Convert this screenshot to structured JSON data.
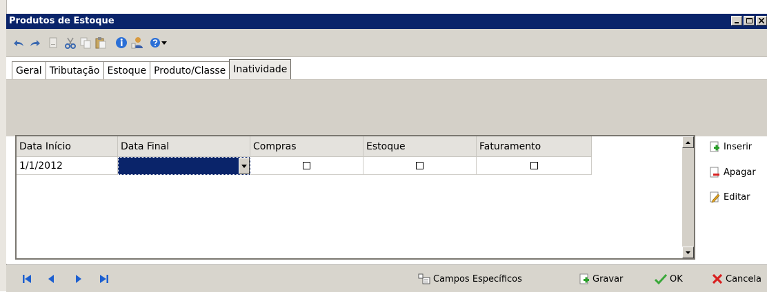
{
  "window": {
    "title": "Produtos de Estoque",
    "colors": {
      "titlebar": "#0a246a",
      "selection": "#0a246a"
    }
  },
  "toolbar": {
    "icons": [
      "undo-icon",
      "redo-icon",
      "new-icon",
      "cut-icon",
      "copy-icon",
      "paste-icon",
      "info-icon",
      "user-icon",
      "help-icon",
      "dropdown-arrow-icon"
    ]
  },
  "tabs": [
    {
      "label": "Geral"
    },
    {
      "label": "Tributação"
    },
    {
      "label": "Estoque"
    },
    {
      "label": "Produto/Classe"
    },
    {
      "label": "Inatividade",
      "active": true
    }
  ],
  "grid": {
    "columns": [
      "Data Início",
      "Data Final",
      "Compras",
      "Estoque",
      "Faturamento"
    ],
    "rows": [
      {
        "data_inicio": "1/1/2012",
        "data_final": "",
        "compras": false,
        "estoque": false,
        "faturamento": false
      }
    ]
  },
  "side_actions": {
    "inserir": "Inserir",
    "apagar": "Apagar",
    "editar": "Editar"
  },
  "statusbar": {
    "campos_especificos": "Campos Específicos",
    "gravar": "Gravar",
    "ok": "OK",
    "cancelar": "Cancela"
  }
}
